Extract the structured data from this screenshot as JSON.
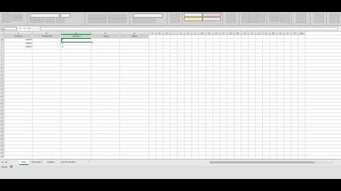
{
  "formula_bar": {
    "name_box": "C2",
    "cancel_icon": "×",
    "enter_icon": "✓",
    "fx_label": "fx",
    "formula": ""
  },
  "columns": [
    "A",
    "B",
    "C",
    "D",
    "E",
    "F",
    "G",
    "H",
    "I",
    "J",
    "K",
    "L",
    "M",
    "N",
    "O",
    "P",
    "Q",
    "R",
    "S",
    "T",
    "U",
    "V",
    "W",
    "X",
    "Y",
    "Z",
    "AA"
  ],
  "rows": [
    "1",
    "2",
    "3",
    "4",
    "5",
    "6",
    "7",
    "8",
    "9",
    "10",
    "11",
    "12",
    "13",
    "14",
    "15",
    "16",
    "17",
    "18",
    "19",
    "20",
    "21",
    "22",
    "23",
    "24",
    "25",
    "26",
    "27",
    "28",
    "29",
    "30",
    "31",
    "32",
    "33",
    "34",
    "35"
  ],
  "table": {
    "headers": [
      "Product",
      "Product ID",
      "Category",
      "Value",
      "Value"
    ],
    "products": [
      "100PX",
      "100PX",
      "100PX"
    ],
    "row_values": [
      "0",
      "0",
      "0"
    ]
  },
  "sheet_tabs": [
    "Data",
    "Preparation",
    "Updates",
    "Forming Method"
  ],
  "add_sheet": "+",
  "status": {
    "ready": "Ready"
  },
  "colors": {
    "accent": "#217346",
    "ribbon": "#d4d4d4"
  }
}
